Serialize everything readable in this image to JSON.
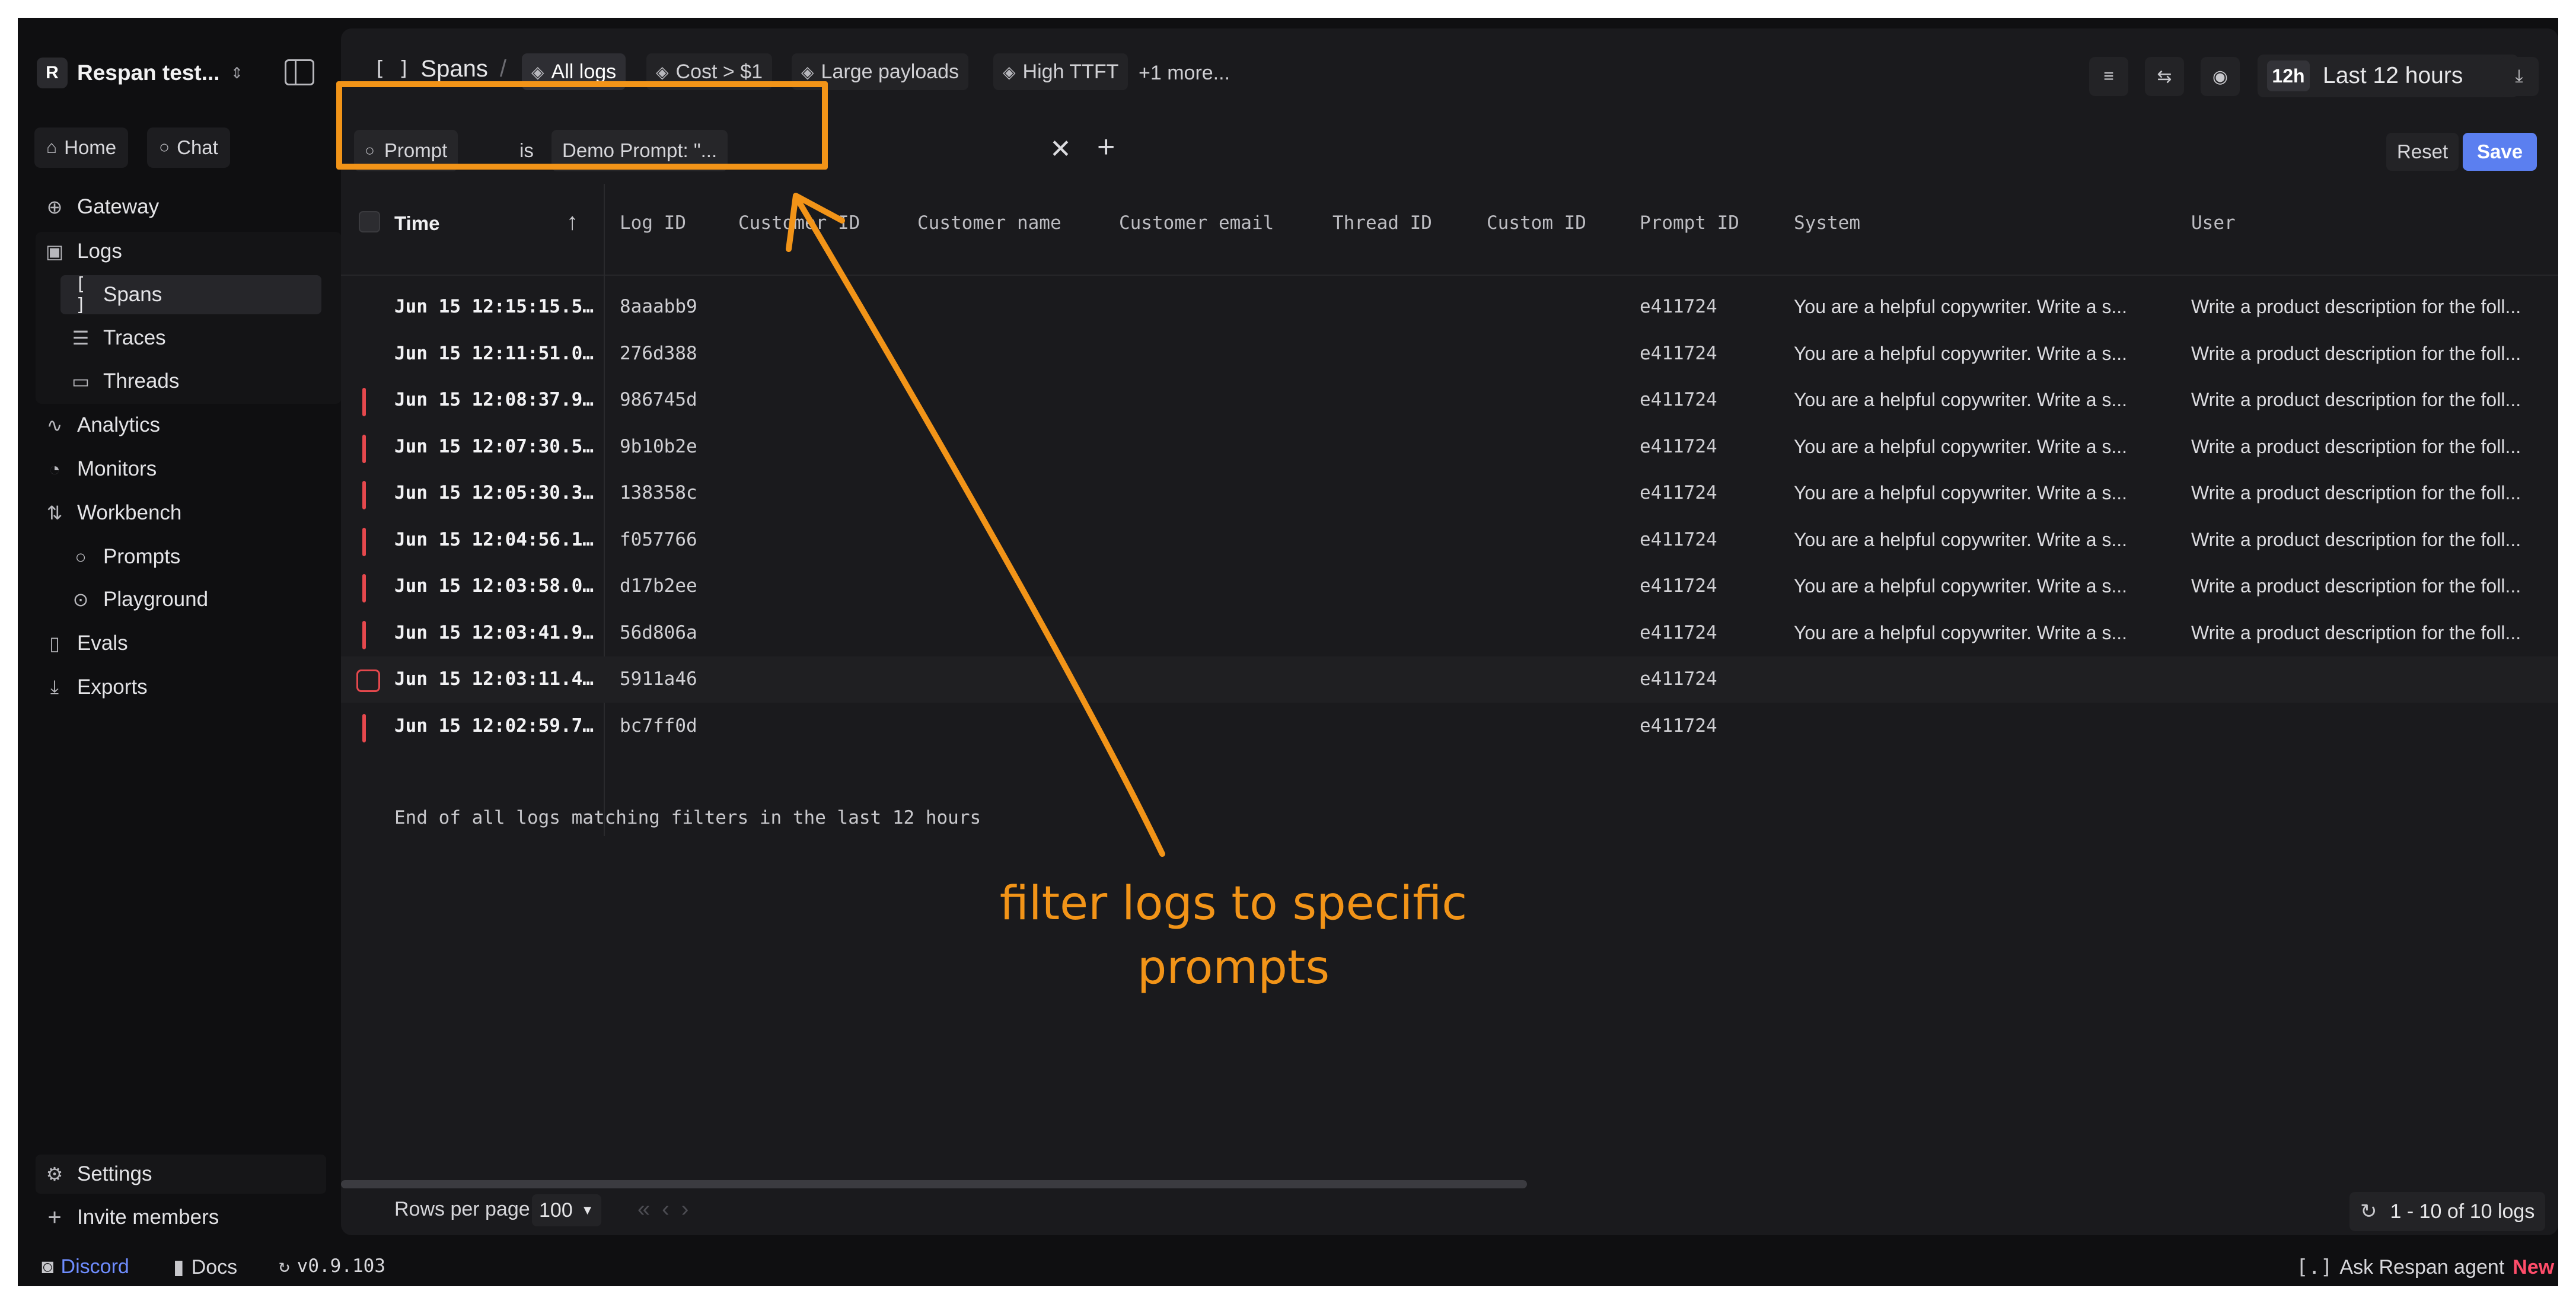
{
  "workspace": {
    "badge": "R",
    "name": "Respan test...",
    "chevron": "⇕"
  },
  "quick_links": [
    {
      "label": "Home",
      "icon": "home-icon"
    },
    {
      "label": "Chat",
      "icon": "chat-icon"
    }
  ],
  "nav": {
    "gateway": "Gateway",
    "logs": "Logs",
    "spans": "Spans",
    "traces": "Traces",
    "threads": "Threads",
    "analytics": "Analytics",
    "monitors": "Monitors",
    "workbench": "Workbench",
    "prompts": "Prompts",
    "playground": "Playground",
    "evals": "Evals",
    "exports": "Exports",
    "settings": "Settings",
    "invite": "Invite members"
  },
  "bottom": {
    "discord": "Discord",
    "docs": "Docs",
    "version": "v0.9.103",
    "ask_agent": "Ask Respan agent",
    "new_badge": "New"
  },
  "topbar": {
    "crumb_icon": "[ ]",
    "crumb": "Spans",
    "crumb_sep": "/",
    "views": [
      "All logs",
      "Cost > $1",
      "Large payloads",
      "High TTFT"
    ],
    "more_views": "+1 more...",
    "range_badge": "12h",
    "range_label": "Last 12 hours"
  },
  "filter": {
    "field": "Prompt",
    "operator": "is",
    "value": "Demo Prompt: \"...",
    "reset": "Reset",
    "save": "Save"
  },
  "table": {
    "columns": [
      "Time",
      "Log ID",
      "Customer ID",
      "Customer name",
      "Customer email",
      "Thread ID",
      "Custom ID",
      "Prompt ID",
      "System",
      "User"
    ],
    "rows": [
      {
        "time": "Jun 15 12:15:15.5…",
        "log_id": "8aaabb9",
        "prompt_id": "e411724",
        "system": "You are a helpful copywriter. Write a s...",
        "user": "Write a product description for the foll...",
        "flag": "none"
      },
      {
        "time": "Jun 15 12:11:51.0…",
        "log_id": "276d388",
        "prompt_id": "e411724",
        "system": "You are a helpful copywriter. Write a s...",
        "user": "Write a product description for the foll...",
        "flag": "none"
      },
      {
        "time": "Jun 15 12:08:37.9…",
        "log_id": "986745d",
        "prompt_id": "e411724",
        "system": "You are a helpful copywriter. Write a s...",
        "user": "Write a product description for the foll...",
        "flag": "error"
      },
      {
        "time": "Jun 15 12:07:30.5…",
        "log_id": "9b10b2e",
        "prompt_id": "e411724",
        "system": "You are a helpful copywriter. Write a s...",
        "user": "Write a product description for the foll...",
        "flag": "error"
      },
      {
        "time": "Jun 15 12:05:30.3…",
        "log_id": "138358c",
        "prompt_id": "e411724",
        "system": "You are a helpful copywriter. Write a s...",
        "user": "Write a product description for the foll...",
        "flag": "error"
      },
      {
        "time": "Jun 15 12:04:56.1…",
        "log_id": "f057766",
        "prompt_id": "e411724",
        "system": "You are a helpful copywriter. Write a s...",
        "user": "Write a product description for the foll...",
        "flag": "error"
      },
      {
        "time": "Jun 15 12:03:58.0…",
        "log_id": "d17b2ee",
        "prompt_id": "e411724",
        "system": "You are a helpful copywriter. Write a s...",
        "user": "Write a product description for the foll...",
        "flag": "error"
      },
      {
        "time": "Jun 15 12:03:41.9…",
        "log_id": "56d806a",
        "prompt_id": "e411724",
        "system": "You are a helpful copywriter. Write a s...",
        "user": "Write a product description for the foll...",
        "flag": "error"
      },
      {
        "time": "Jun 15 12:03:11.4…",
        "log_id": "5911a46",
        "prompt_id": "e411724",
        "system": "",
        "user": "",
        "flag": "selected"
      },
      {
        "time": "Jun 15 12:02:59.7…",
        "log_id": "bc7ff0d",
        "prompt_id": "e411724",
        "system": "",
        "user": "",
        "flag": "error"
      }
    ],
    "end_note": "End of all logs matching filters in the last 12 hours"
  },
  "footer": {
    "rows_per_page_label": "Rows per page",
    "rows_per_page": "100",
    "range_text": "1 - 10 of 10 logs"
  },
  "annotation": {
    "line1": "filter logs to specific",
    "line2": "prompts",
    "color": "#f29418"
  },
  "colors": {
    "accent": "#5b7ff0",
    "error": "#e5484d",
    "annotation": "#f29418"
  }
}
